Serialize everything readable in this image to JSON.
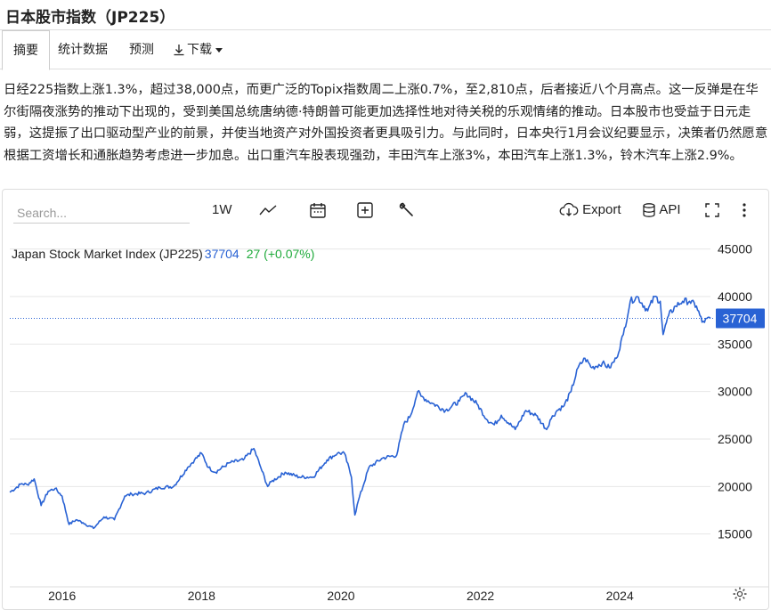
{
  "page": {
    "title": "日本股市指数（JP225）"
  },
  "tabs": [
    {
      "label": "摘要",
      "active": true
    },
    {
      "label": "统计数据",
      "active": false
    },
    {
      "label": "预测",
      "active": false
    },
    {
      "label": "下载",
      "active": false
    }
  ],
  "summary": "日经225指数上涨1.3%，超过38,000点，而更广泛的Topix指数周二上涨0.7%，至2,810点，后者接近八个月高点。这一反弹是在华尔街隔夜涨势的推动下出现的，受到美国总统唐纳德·特朗普可能更加选择性地对待关税的乐观情绪的推动。日本股市也受益于日元走弱，这提振了出口驱动型产业的前景，并使当地资产对外国投资者更具吸引力。与此同时，日本央行1月会议纪要显示，决策者仍然愿意根据工资增长和通胀趋势考虑进一步加息。出口重汽车股表现强劲，丰田汽车上涨3%，本田汽车上涨1.3%，铃木汽车上涨2.9%。",
  "toolbar": {
    "search_placeholder": "Search...",
    "range_label": "1W",
    "export_label": "Export",
    "api_label": "API",
    "icons": [
      "line-chart-icon",
      "calendar-icon",
      "plus-box-icon",
      "wrench-icon",
      "cloud-download-icon",
      "database-icon",
      "fullscreen-icon",
      "more-vertical-icon",
      "settings-gear-icon"
    ]
  },
  "legend": {
    "name": "Japan Stock Market Index (JP225)",
    "value": "37704",
    "change": "27 (+0.07%)"
  },
  "colors": {
    "series": "#2962d4",
    "change_up": "#1faa3b",
    "grid": "#e6e6e6"
  },
  "chart_data": {
    "type": "line",
    "x_ticks": [
      "2016",
      "2018",
      "2020",
      "2022",
      "2024"
    ],
    "y_ticks": [
      15000,
      20000,
      25000,
      30000,
      35000,
      40000,
      45000
    ],
    "ylim": [
      10000,
      47500
    ],
    "xlim": [
      2015.25,
      2025.3
    ],
    "last_value_label": "37704",
    "series": [
      {
        "x": [
          2015.25,
          2015.42,
          2015.5,
          2015.6,
          2015.7,
          2015.8,
          2015.9,
          2016.0,
          2016.1,
          2016.2,
          2016.3,
          2016.45,
          2016.6,
          2016.75,
          2016.9,
          2017.0,
          2017.2,
          2017.4,
          2017.6,
          2017.8,
          2017.9,
          2018.0,
          2018.1,
          2018.2,
          2018.4,
          2018.6,
          2018.75,
          2018.85,
          2018.95,
          2019.0,
          2019.2,
          2019.4,
          2019.6,
          2019.8,
          2019.95,
          2020.05,
          2020.15,
          2020.2,
          2020.25,
          2020.4,
          2020.6,
          2020.8,
          2020.9,
          2021.0,
          2021.1,
          2021.15,
          2021.3,
          2021.5,
          2021.7,
          2021.8,
          2021.95,
          2022.1,
          2022.2,
          2022.3,
          2022.5,
          2022.65,
          2022.8,
          2022.95,
          2023.0,
          2023.1,
          2023.2,
          2023.3,
          2023.4,
          2023.5,
          2023.6,
          2023.75,
          2023.85,
          2023.95,
          2024.05,
          2024.15,
          2024.25,
          2024.4,
          2024.5,
          2024.58,
          2024.62,
          2024.7,
          2024.8,
          2024.9,
          2025.0,
          2025.1,
          2025.18,
          2025.3
        ],
        "y": [
          19400,
          20300,
          20200,
          20800,
          18000,
          19500,
          19800,
          19000,
          16000,
          16500,
          16200,
          15600,
          16800,
          16500,
          19000,
          19200,
          19300,
          19900,
          20000,
          22000,
          22800,
          23500,
          22000,
          21500,
          22500,
          22800,
          24000,
          22000,
          20000,
          20500,
          21500,
          21000,
          21000,
          22800,
          23500,
          23500,
          21000,
          17000,
          18500,
          22000,
          23000,
          23300,
          26500,
          27500,
          30000,
          29500,
          28800,
          28000,
          29000,
          29800,
          28700,
          27000,
          26500,
          27500,
          26000,
          28000,
          27500,
          26000,
          27000,
          28000,
          28500,
          30000,
          32500,
          33500,
          32500,
          33000,
          32500,
          33500,
          36000,
          39500,
          40000,
          38500,
          40000,
          39500,
          36000,
          38000,
          39000,
          39500,
          39500,
          39000,
          37300,
          37704
        ]
      }
    ]
  }
}
